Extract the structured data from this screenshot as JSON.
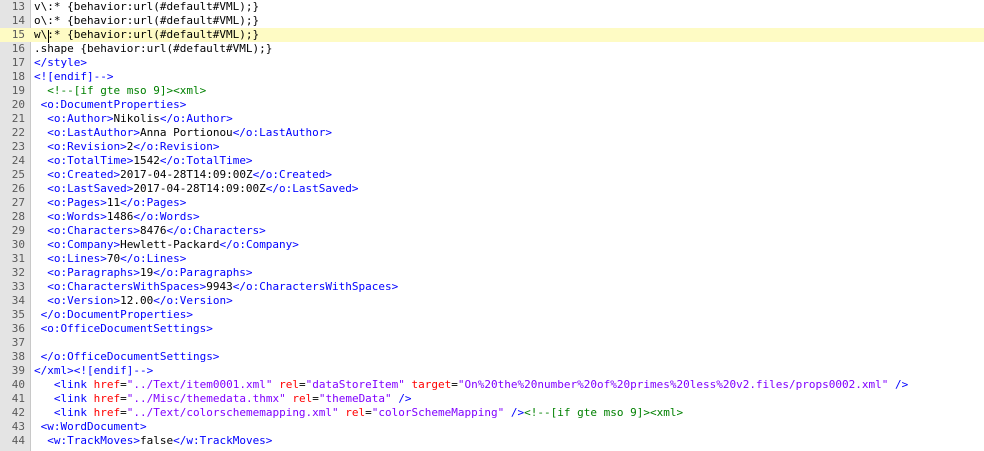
{
  "editor": {
    "colors": {
      "text": "#000000",
      "tag": "#0000ff",
      "attr": "#ff0000",
      "value": "#8000ff",
      "comment": "#008000",
      "gutter_bg": "#e4e4e4",
      "current_line_bg": "#fefbc4"
    },
    "current_line": 15,
    "lines": [
      {
        "n": "13",
        "tokens": [
          [
            "text",
            "v\\:* {behavior:url(#default#VML);}"
          ]
        ]
      },
      {
        "n": "14",
        "tokens": [
          [
            "text",
            "o\\:* {behavior:url(#default#VML);}"
          ]
        ]
      },
      {
        "n": "15",
        "tokens": [
          [
            "text",
            "w\\:* {behavior:url(#default#VML);}"
          ]
        ]
      },
      {
        "n": "16",
        "tokens": [
          [
            "text",
            ".shape {behavior:url(#default#VML);}"
          ]
        ]
      },
      {
        "n": "17",
        "tokens": [
          [
            "tag",
            "</style>"
          ]
        ]
      },
      {
        "n": "18",
        "tokens": [
          [
            "tag",
            "<![endif]-->"
          ]
        ]
      },
      {
        "n": "19",
        "tokens": [
          [
            "text",
            "  "
          ],
          [
            "cmt",
            "<!--[if gte mso 9]><xml>"
          ]
        ]
      },
      {
        "n": "20",
        "tokens": [
          [
            "text",
            " "
          ],
          [
            "tag",
            "<o:DocumentProperties>"
          ]
        ]
      },
      {
        "n": "21",
        "tokens": [
          [
            "text",
            "  "
          ],
          [
            "tag",
            "<o:Author>"
          ],
          [
            "text",
            "Nikolis"
          ],
          [
            "tag",
            "</o:Author>"
          ]
        ]
      },
      {
        "n": "22",
        "tokens": [
          [
            "text",
            "  "
          ],
          [
            "tag",
            "<o:LastAuthor>"
          ],
          [
            "text",
            "Anna Portionou"
          ],
          [
            "tag",
            "</o:LastAuthor>"
          ]
        ]
      },
      {
        "n": "23",
        "tokens": [
          [
            "text",
            "  "
          ],
          [
            "tag",
            "<o:Revision>"
          ],
          [
            "text",
            "2"
          ],
          [
            "tag",
            "</o:Revision>"
          ]
        ]
      },
      {
        "n": "24",
        "tokens": [
          [
            "text",
            "  "
          ],
          [
            "tag",
            "<o:TotalTime>"
          ],
          [
            "text",
            "1542"
          ],
          [
            "tag",
            "</o:TotalTime>"
          ]
        ]
      },
      {
        "n": "25",
        "tokens": [
          [
            "text",
            "  "
          ],
          [
            "tag",
            "<o:Created>"
          ],
          [
            "text",
            "2017-04-28T14:09:00Z"
          ],
          [
            "tag",
            "</o:Created>"
          ]
        ]
      },
      {
        "n": "26",
        "tokens": [
          [
            "text",
            "  "
          ],
          [
            "tag",
            "<o:LastSaved>"
          ],
          [
            "text",
            "2017-04-28T14:09:00Z"
          ],
          [
            "tag",
            "</o:LastSaved>"
          ]
        ]
      },
      {
        "n": "27",
        "tokens": [
          [
            "text",
            "  "
          ],
          [
            "tag",
            "<o:Pages>"
          ],
          [
            "text",
            "11"
          ],
          [
            "tag",
            "</o:Pages>"
          ]
        ]
      },
      {
        "n": "28",
        "tokens": [
          [
            "text",
            "  "
          ],
          [
            "tag",
            "<o:Words>"
          ],
          [
            "text",
            "1486"
          ],
          [
            "tag",
            "</o:Words>"
          ]
        ]
      },
      {
        "n": "29",
        "tokens": [
          [
            "text",
            "  "
          ],
          [
            "tag",
            "<o:Characters>"
          ],
          [
            "text",
            "8476"
          ],
          [
            "tag",
            "</o:Characters>"
          ]
        ]
      },
      {
        "n": "30",
        "tokens": [
          [
            "text",
            "  "
          ],
          [
            "tag",
            "<o:Company>"
          ],
          [
            "text",
            "Hewlett-Packard"
          ],
          [
            "tag",
            "</o:Company>"
          ]
        ]
      },
      {
        "n": "31",
        "tokens": [
          [
            "text",
            "  "
          ],
          [
            "tag",
            "<o:Lines>"
          ],
          [
            "text",
            "70"
          ],
          [
            "tag",
            "</o:Lines>"
          ]
        ]
      },
      {
        "n": "32",
        "tokens": [
          [
            "text",
            "  "
          ],
          [
            "tag",
            "<o:Paragraphs>"
          ],
          [
            "text",
            "19"
          ],
          [
            "tag",
            "</o:Paragraphs>"
          ]
        ]
      },
      {
        "n": "33",
        "tokens": [
          [
            "text",
            "  "
          ],
          [
            "tag",
            "<o:CharactersWithSpaces>"
          ],
          [
            "text",
            "9943"
          ],
          [
            "tag",
            "</o:CharactersWithSpaces>"
          ]
        ]
      },
      {
        "n": "34",
        "tokens": [
          [
            "text",
            "  "
          ],
          [
            "tag",
            "<o:Version>"
          ],
          [
            "text",
            "12.00"
          ],
          [
            "tag",
            "</o:Version>"
          ]
        ]
      },
      {
        "n": "35",
        "tokens": [
          [
            "text",
            " "
          ],
          [
            "tag",
            "</o:DocumentProperties>"
          ]
        ]
      },
      {
        "n": "36",
        "tokens": [
          [
            "text",
            " "
          ],
          [
            "tag",
            "<o:OfficeDocumentSettings>"
          ]
        ]
      },
      {
        "n": "37",
        "tokens": []
      },
      {
        "n": "38",
        "tokens": [
          [
            "text",
            " "
          ],
          [
            "tag",
            "</o:OfficeDocumentSettings>"
          ]
        ]
      },
      {
        "n": "39",
        "tokens": [
          [
            "tag",
            "</xml>"
          ],
          [
            "tag",
            "<![endif]-->"
          ]
        ]
      },
      {
        "n": "40",
        "tokens": [
          [
            "text",
            "   "
          ],
          [
            "tag",
            "<link"
          ],
          [
            "text",
            " "
          ],
          [
            "attr",
            "href"
          ],
          [
            "pun",
            "="
          ],
          [
            "val",
            "\"../Text/item0001.xml\""
          ],
          [
            "text",
            " "
          ],
          [
            "attr",
            "rel"
          ],
          [
            "pun",
            "="
          ],
          [
            "val",
            "\"dataStoreItem\""
          ],
          [
            "text",
            " "
          ],
          [
            "attr",
            "target"
          ],
          [
            "pun",
            "="
          ],
          [
            "val",
            "\"On%20the%20number%20of%20primes%20less%20v2.files/props0002.xml\""
          ],
          [
            "text",
            " "
          ],
          [
            "tag",
            "/>"
          ]
        ]
      },
      {
        "n": "41",
        "tokens": [
          [
            "text",
            "   "
          ],
          [
            "tag",
            "<link"
          ],
          [
            "text",
            " "
          ],
          [
            "attr",
            "href"
          ],
          [
            "pun",
            "="
          ],
          [
            "val",
            "\"../Misc/themedata.thmx\""
          ],
          [
            "text",
            " "
          ],
          [
            "attr",
            "rel"
          ],
          [
            "pun",
            "="
          ],
          [
            "val",
            "\"themeData\""
          ],
          [
            "text",
            " "
          ],
          [
            "tag",
            "/>"
          ]
        ]
      },
      {
        "n": "42",
        "tokens": [
          [
            "text",
            "   "
          ],
          [
            "tag",
            "<link"
          ],
          [
            "text",
            " "
          ],
          [
            "attr",
            "href"
          ],
          [
            "pun",
            "="
          ],
          [
            "val",
            "\"../Text/colorschememapping.xml\""
          ],
          [
            "text",
            " "
          ],
          [
            "attr",
            "rel"
          ],
          [
            "pun",
            "="
          ],
          [
            "val",
            "\"colorSchemeMapping\""
          ],
          [
            "text",
            " "
          ],
          [
            "tag",
            "/>"
          ],
          [
            "cmt",
            "<!--[if gte mso 9]><xml>"
          ]
        ]
      },
      {
        "n": "43",
        "tokens": [
          [
            "text",
            " "
          ],
          [
            "tag",
            "<w:WordDocument>"
          ]
        ]
      },
      {
        "n": "44",
        "tokens": [
          [
            "text",
            "  "
          ],
          [
            "tag",
            "<w:TrackMoves>"
          ],
          [
            "text",
            "false"
          ],
          [
            "tag",
            "</w:TrackMoves>"
          ]
        ]
      }
    ]
  }
}
